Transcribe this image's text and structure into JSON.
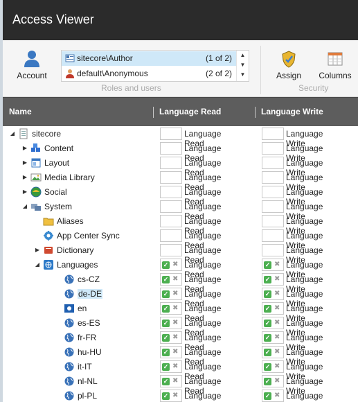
{
  "window": {
    "title": "Access Viewer"
  },
  "ribbon": {
    "account_label": "Account",
    "assign_label": "Assign",
    "columns_label": "Columns",
    "roles_group_label": "Roles and users",
    "security_group_label": "Security",
    "roles": [
      {
        "name": "sitecore\\Author",
        "count": "(1 of 2)",
        "selected": true,
        "icon": "role-icon"
      },
      {
        "name": "default\\Anonymous",
        "count": "(2 of 2)",
        "selected": false,
        "icon": "user-icon"
      }
    ]
  },
  "grid": {
    "col_name": "Name",
    "col_read": "Language Read",
    "col_write": "Language Write",
    "perm_read_label": "Language Read",
    "perm_write_label": "Language Write",
    "rows": [
      {
        "label": "sitecore",
        "depth": 0,
        "expander": "expanded",
        "icon": "page-icon",
        "read": "none",
        "write": "none"
      },
      {
        "label": "Content",
        "depth": 1,
        "expander": "collapsed",
        "icon": "content-icon",
        "read": "none",
        "write": "none"
      },
      {
        "label": "Layout",
        "depth": 1,
        "expander": "collapsed",
        "icon": "layout-icon",
        "read": "none",
        "write": "none"
      },
      {
        "label": "Media Library",
        "depth": 1,
        "expander": "collapsed",
        "icon": "media-library-icon",
        "read": "none",
        "write": "none"
      },
      {
        "label": "Social",
        "depth": 1,
        "expander": "collapsed",
        "icon": "social-icon",
        "read": "none",
        "write": "none"
      },
      {
        "label": "System",
        "depth": 1,
        "expander": "expanded",
        "icon": "system-icon",
        "read": "none",
        "write": "none"
      },
      {
        "label": "Aliases",
        "depth": 2,
        "expander": "none",
        "icon": "folder-icon",
        "read": "none",
        "write": "none"
      },
      {
        "label": "App Center Sync",
        "depth": 2,
        "expander": "none",
        "icon": "gear-icon",
        "read": "none",
        "write": "none"
      },
      {
        "label": "Dictionary",
        "depth": 2,
        "expander": "collapsed",
        "icon": "book-icon",
        "read": "none",
        "write": "none"
      },
      {
        "label": "Languages",
        "depth": 2,
        "expander": "expanded",
        "icon": "languages-icon",
        "read": "allowed",
        "write": "allowed"
      },
      {
        "label": "cs-CZ",
        "depth": 3,
        "expander": "none",
        "icon": "globe-icon",
        "read": "allowed",
        "write": "allowed"
      },
      {
        "label": "de-DE",
        "depth": 3,
        "expander": "none",
        "icon": "globe-icon",
        "read": "allowed",
        "write": "allowed",
        "selected": true
      },
      {
        "label": "en",
        "depth": 3,
        "expander": "none",
        "icon": "flag-icon",
        "read": "allowed",
        "write": "allowed"
      },
      {
        "label": "es-ES",
        "depth": 3,
        "expander": "none",
        "icon": "globe-icon",
        "read": "allowed",
        "write": "allowed"
      },
      {
        "label": "fr-FR",
        "depth": 3,
        "expander": "none",
        "icon": "globe-icon",
        "read": "allowed",
        "write": "allowed"
      },
      {
        "label": "hu-HU",
        "depth": 3,
        "expander": "none",
        "icon": "globe-icon",
        "read": "allowed",
        "write": "allowed"
      },
      {
        "label": "it-IT",
        "depth": 3,
        "expander": "none",
        "icon": "globe-icon",
        "read": "allowed",
        "write": "allowed"
      },
      {
        "label": "nl-NL",
        "depth": 3,
        "expander": "none",
        "icon": "globe-icon",
        "read": "allowed",
        "write": "allowed"
      },
      {
        "label": "pl-PL",
        "depth": 3,
        "expander": "none",
        "icon": "globe-icon",
        "read": "allowed",
        "write": "allowed"
      }
    ]
  }
}
